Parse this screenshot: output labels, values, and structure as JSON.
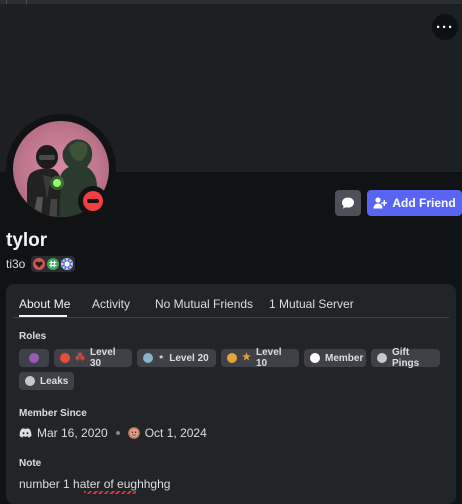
{
  "profile": {
    "display_name": "tylor",
    "username": "ti3o",
    "status": "Do Not Disturb",
    "avatar": "avatar-image"
  },
  "header": {
    "more_icon": "ellipsis-icon",
    "more_label": "···"
  },
  "actions": {
    "message_icon": "chat-bubble-icon",
    "add_friend_label": "Add Friend",
    "add_friend_icon": "person-plus-icon"
  },
  "badges": [
    "heart-badge",
    "hashtag-badge",
    "sun-badge"
  ],
  "tabs": [
    {
      "label": "About Me",
      "active": true
    },
    {
      "label": "Activity",
      "active": false
    },
    {
      "label": "No Mutual Friends",
      "active": false
    },
    {
      "label": "1 Mutual Server",
      "active": false
    }
  ],
  "roles": {
    "heading": "Roles",
    "items": [
      {
        "label": "",
        "color": "#9b59b6",
        "icon": ""
      },
      {
        "label": "Level 30",
        "color": "#e74c3c",
        "icon": "⁂"
      },
      {
        "label": "Level 20",
        "color": "#8ab4c9",
        "icon": "⋆"
      },
      {
        "label": "Level 10",
        "color": "#e6a23c",
        "icon": "★"
      },
      {
        "label": "Member",
        "color": "#ffffff",
        "icon": ""
      },
      {
        "label": "Gift Pings",
        "color": "#c4c9ce",
        "icon": ""
      },
      {
        "label": "Leaks",
        "color": "#c4c9ce",
        "icon": ""
      }
    ]
  },
  "member_since": {
    "heading": "Member Since",
    "discord_date": "Mar 16, 2020",
    "server_date": "Oct 1, 2024",
    "discord_icon": "discord-logo-icon",
    "server_icon": "server-icon"
  },
  "note": {
    "heading": "Note",
    "text": "number 1 hater of eughhghg"
  },
  "colors": {
    "background": "#111214",
    "banner": "#1e1f22",
    "card": "#232428",
    "accent": "#5865f2",
    "dnd": "#f23f43"
  }
}
